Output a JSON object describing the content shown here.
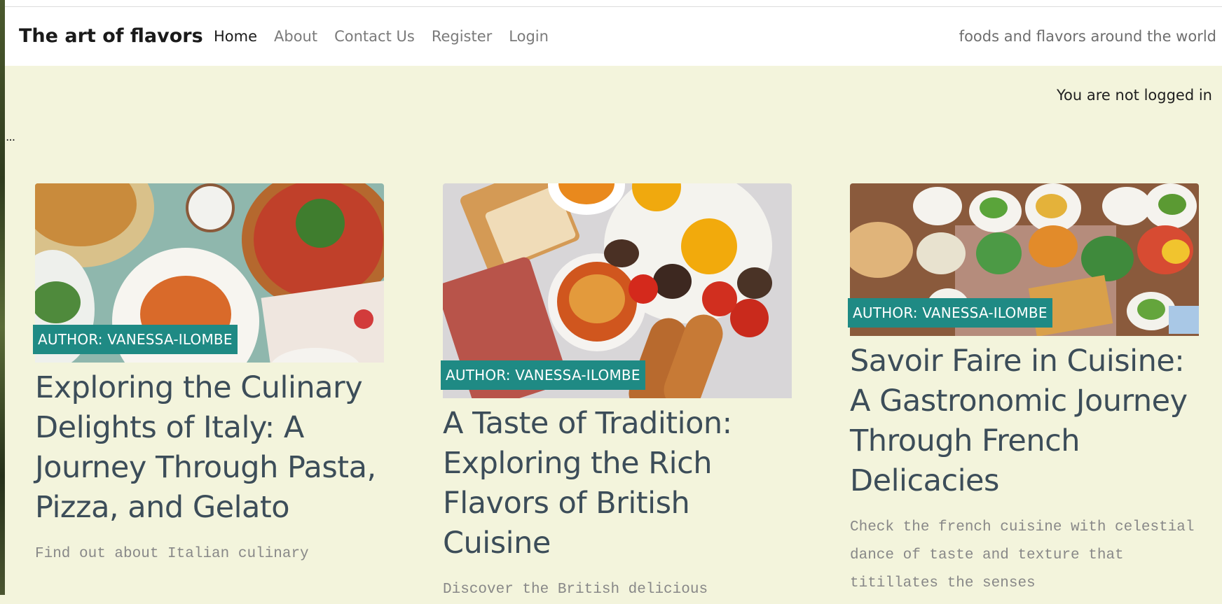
{
  "navbar": {
    "brand": "The art of flavors",
    "links": [
      {
        "label": "Home",
        "active": true
      },
      {
        "label": "About",
        "active": false
      },
      {
        "label": "Contact Us",
        "active": false
      },
      {
        "label": "Register",
        "active": false
      },
      {
        "label": "Login",
        "active": false
      }
    ],
    "tagline": "foods and flavors around the world"
  },
  "status": {
    "login_text": "You are not logged in",
    "ellipsis": "..."
  },
  "posts": [
    {
      "author_badge": "AUTHOR: VANESSA-ILOMBE",
      "title": "Exploring the Culinary Delights of Italy: A Journey Through Pasta, Pizza, and Gelato",
      "excerpt": "Find out about Italian culinary",
      "image_alt": "italian-food-photo"
    },
    {
      "author_badge": "AUTHOR: VANESSA-ILOMBE",
      "title": "A Taste of Tradition: Exploring the Rich Flavors of British Cuisine",
      "excerpt": "Discover the British delicious",
      "image_alt": "british-breakfast-photo"
    },
    {
      "author_badge": "AUTHOR: VANESSA-ILOMBE",
      "title": "Savoir Faire in Cuisine: A Gastronomic Journey Through French Delicacies",
      "excerpt": "Check the french cuisine with celestial dance of taste and texture that titillates the senses",
      "image_alt": "french-table-photo"
    }
  ],
  "colors": {
    "page_background": "#f3f4dc",
    "badge": "#1f8a84",
    "title": "#3c4d59"
  }
}
